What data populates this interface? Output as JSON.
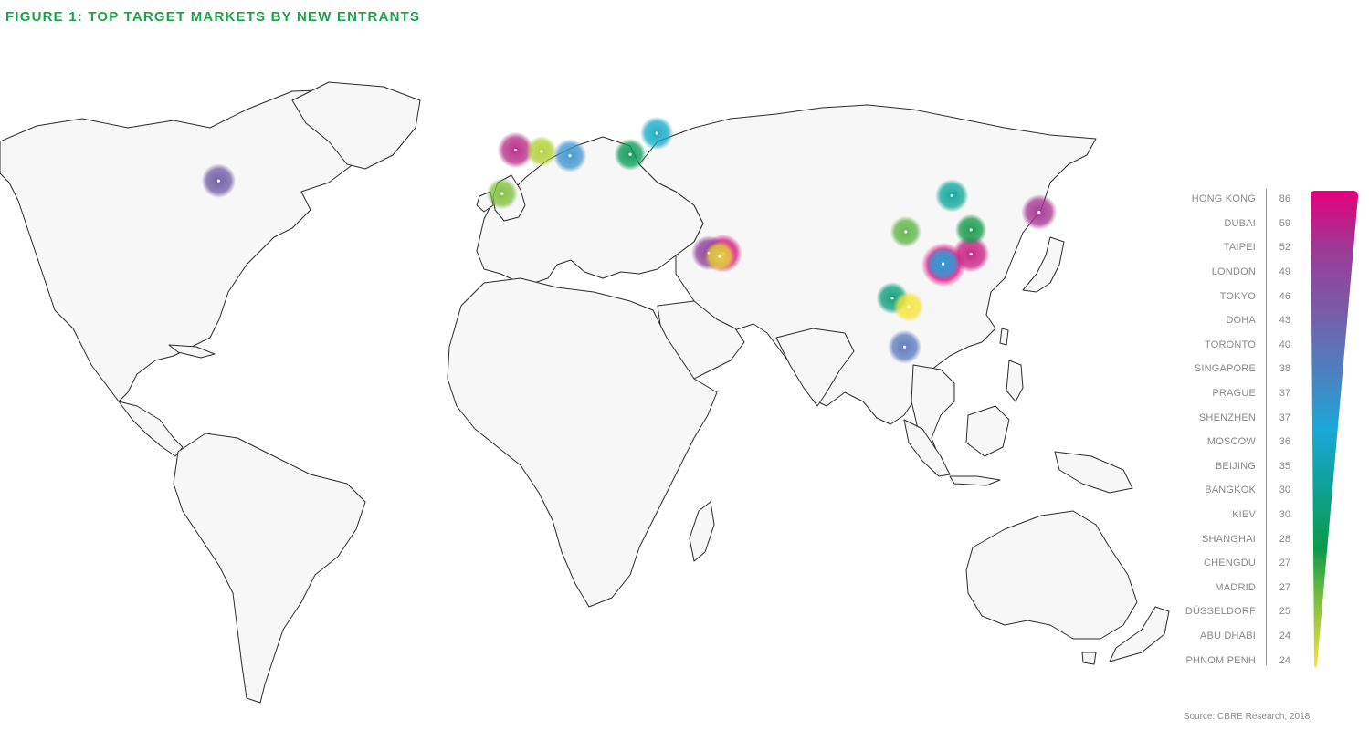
{
  "figure": {
    "title": "FIGURE 1: TOP TARGET MARKETS BY NEW ENTRANTS",
    "source": "Source: CBRE Research, 2018."
  },
  "scale": {
    "colors": [
      "#e4007c",
      "#9b3b95",
      "#7b5ba8",
      "#4f7fbf",
      "#1aa8d9",
      "#0fa096",
      "#0a9a4a",
      "#8bc53f",
      "#f5e53a"
    ]
  },
  "markets": [
    {
      "city": "HONG KONG",
      "value": 86,
      "color": "#e4007c",
      "lon": 114.2,
      "lat": 22.3
    },
    {
      "city": "DUBAI",
      "value": 59,
      "color": "#d4147f",
      "lon": 55.3,
      "lat": 25.2
    },
    {
      "city": "TAIPEI",
      "value": 52,
      "color": "#c81d80",
      "lon": 121.5,
      "lat": 25.0
    },
    {
      "city": "LONDON",
      "value": 49,
      "color": "#b52886",
      "lon": -0.1,
      "lat": 51.5
    },
    {
      "city": "TOKYO",
      "value": 46,
      "color": "#a2338f",
      "lon": 139.7,
      "lat": 35.7
    },
    {
      "city": "DOHA",
      "value": 43,
      "color": "#8a3c97",
      "lon": 51.5,
      "lat": 25.3
    },
    {
      "city": "TORONTO",
      "value": 40,
      "color": "#6e5aa6",
      "lon": -79.4,
      "lat": 43.7
    },
    {
      "city": "SINGAPORE",
      "value": 38,
      "color": "#5a78ba",
      "lon": 103.8,
      "lat": 1.35
    },
    {
      "city": "PRAGUE",
      "value": 37,
      "color": "#3f95cf",
      "lon": 14.4,
      "lat": 50.1
    },
    {
      "city": "SHENZHEN",
      "value": 37,
      "color": "#25a5d8",
      "lon": 114.06,
      "lat": 22.54
    },
    {
      "city": "MOSCOW",
      "value": 36,
      "color": "#14a9c6",
      "lon": 37.6,
      "lat": 55.8
    },
    {
      "city": "BEIJING",
      "value": 35,
      "color": "#0fa59a",
      "lon": 116.4,
      "lat": 39.9
    },
    {
      "city": "BANGKOK",
      "value": 30,
      "color": "#0c9d78",
      "lon": 100.5,
      "lat": 13.8
    },
    {
      "city": "KIEV",
      "value": 30,
      "color": "#0a9a56",
      "lon": 30.5,
      "lat": 50.4
    },
    {
      "city": "SHANGHAI",
      "value": 28,
      "color": "#13984a",
      "lon": 121.5,
      "lat": 31.2
    },
    {
      "city": "CHENGDU",
      "value": 27,
      "color": "#5fb346",
      "lon": 104.1,
      "lat": 30.7
    },
    {
      "city": "MADRID",
      "value": 27,
      "color": "#7fbf3f",
      "lon": -3.7,
      "lat": 40.4
    },
    {
      "city": "DÜSSELDORF",
      "value": 25,
      "color": "#b2cf35",
      "lon": 6.8,
      "lat": 51.2
    },
    {
      "city": "ABU DHABI",
      "value": 24,
      "color": "#e8d83a",
      "lon": 54.4,
      "lat": 24.45
    },
    {
      "city": "PHNOM PENH",
      "value": 24,
      "color": "#f5e53a",
      "lon": 104.9,
      "lat": 11.6
    }
  ]
}
